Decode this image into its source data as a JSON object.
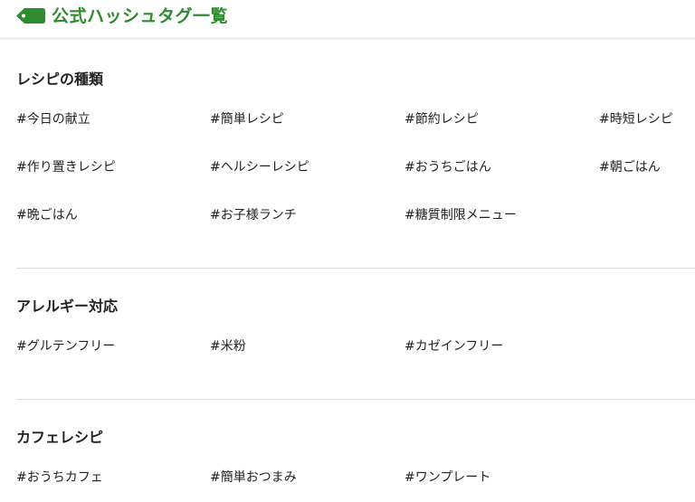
{
  "header": {
    "title": "公式ハッシュタグ一覧",
    "accent_color": "#2e8b2e",
    "icon": "tag-icon"
  },
  "sections": [
    {
      "title": "レシピの種類",
      "tags": [
        "#今日の献立",
        "#簡単レシピ",
        "#節約レシピ",
        "#時短レシピ",
        "#作り置きレシピ",
        "#ヘルシーレシピ",
        "#おうちごはん",
        "#朝ごはん",
        "#晩ごはん",
        "#お子様ランチ",
        "#糖質制限メニュー"
      ]
    },
    {
      "title": "アレルギー対応",
      "tags": [
        "#グルテンフリー",
        "#米粉",
        "#カゼインフリー"
      ]
    },
    {
      "title": "カフェレシピ",
      "tags": [
        "#おうちカフェ",
        "#簡単おつまみ",
        "#ワンプレート"
      ]
    }
  ]
}
